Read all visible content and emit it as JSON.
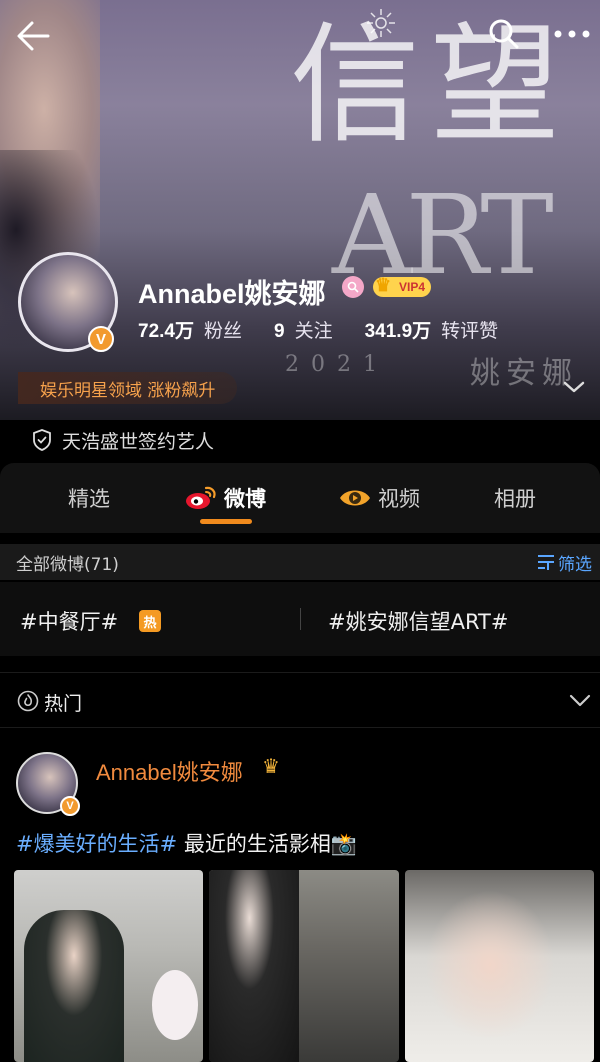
{
  "cover": {
    "art_chars": [
      "信",
      "望"
    ],
    "art_word": "ART",
    "art_year": "2021",
    "art_name": "姚安娜"
  },
  "profile": {
    "username": "Annabel姚安娜",
    "verified_mark": "V",
    "vip_label": "VIP4",
    "stats": [
      {
        "value": "72.4万",
        "label": "粉丝"
      },
      {
        "value": "9",
        "label": "关注"
      },
      {
        "value": "341.9万",
        "label": "转评赞"
      }
    ],
    "domain_tag": "娱乐明星领域 涨粉飙升",
    "verification": "天浩盛世签约艺人"
  },
  "tabs": [
    {
      "label": "精选",
      "active": false
    },
    {
      "label": "微博",
      "active": true
    },
    {
      "label": "视频",
      "active": false
    },
    {
      "label": "相册",
      "active": false
    }
  ],
  "filter": {
    "count_label": "全部微博(71)",
    "button_label": "筛选"
  },
  "topics": [
    {
      "label": "#中餐厅#",
      "badge": "热"
    },
    {
      "label": "#姚安娜信望ART#"
    }
  ],
  "hot_section": {
    "label": "热门"
  },
  "post": {
    "username": "Annabel姚安娜",
    "verified_mark": "V",
    "topic": "#爆美好的生活#",
    "text": " 最近的生活影相📸"
  },
  "icons": {
    "back": "arrow-left-icon",
    "search": "search-icon",
    "more": "more-dots-icon",
    "expand": "chevron-down-icon",
    "shield": "shield-check-icon",
    "weibo": "weibo-logo-icon",
    "video": "video-eye-icon",
    "filter": "filter-lines-icon",
    "hot": "flame-icon",
    "crown": "crown-icon"
  },
  "colors": {
    "accent": "#f08a1d",
    "link": "#6aaeff",
    "tag": "#f7a24c",
    "username_post": "#f08a3e"
  }
}
